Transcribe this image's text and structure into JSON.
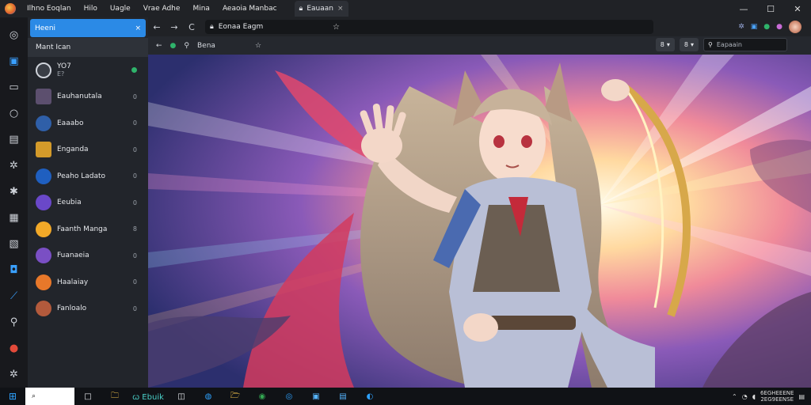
{
  "titlebar": {
    "menu": [
      "Ilhno Eoqlan",
      "Hilo",
      "Uagle",
      "Vrae Adhe",
      "Mina",
      "Aeaoia Manbac"
    ],
    "tab_label": "Eauaan",
    "tab_close": "×"
  },
  "window": {
    "minimize": "—",
    "maximize": "☐",
    "close": "✕"
  },
  "rail_icons": [
    "compass-icon",
    "message-icon",
    "window-icon",
    "circle-icon",
    "save-icon",
    "settings-icon",
    "puzzle-icon",
    "doc-icon",
    "chart-icon",
    "bot-icon",
    "brush-icon",
    "search-icon",
    "shield-icon",
    "more-icon"
  ],
  "panel": {
    "header": "Heeni",
    "header_close": "×",
    "subheader": "Mant Ican",
    "items": [
      {
        "label": "YO7",
        "sub": "E?",
        "meta": "",
        "color": "#3a3e46",
        "badge": "dot"
      },
      {
        "label": "Eauhanutala",
        "meta": "0",
        "color": "#5c4f6e"
      },
      {
        "label": "Eaaabo",
        "meta": "0",
        "color": "#2f5fa8"
      },
      {
        "label": "Enganda",
        "meta": "0",
        "color": "#d39a2a"
      },
      {
        "label": "Peaho Ladato",
        "meta": "0",
        "color": "#1f5fc0"
      },
      {
        "label": "Eeubia",
        "meta": "0",
        "color": "#6a48c9"
      },
      {
        "label": "Faanth Manga",
        "meta": "8",
        "color": "#f2a928"
      },
      {
        "label": "Fuanaeia",
        "meta": "0",
        "color": "#7a4fc4"
      },
      {
        "label": "Haalaiay",
        "meta": "0",
        "color": "#e8782a"
      },
      {
        "label": "Fanloalo",
        "meta": "0",
        "color": "#b35a3c"
      }
    ]
  },
  "nav": {
    "back": "←",
    "forward": "→",
    "reload": "C",
    "address": "Eonaa Eagm",
    "star": "☆"
  },
  "toolbar": {
    "back": "←",
    "site": "Bena",
    "pin": "☆",
    "pill1": "8",
    "pill2": "8",
    "search_placeholder": "Eapaain"
  },
  "taskbar": {
    "start": "⊞",
    "search": "⌕",
    "items": [
      "□",
      "🗀",
      "ꞷ Ebuik",
      "◫",
      "◍",
      "🗁",
      "◉",
      "◎",
      "▣",
      "▤",
      "◐"
    ],
    "clock_line1": "6EGHEEENE",
    "clock_line2": "2EG9EENSE"
  }
}
